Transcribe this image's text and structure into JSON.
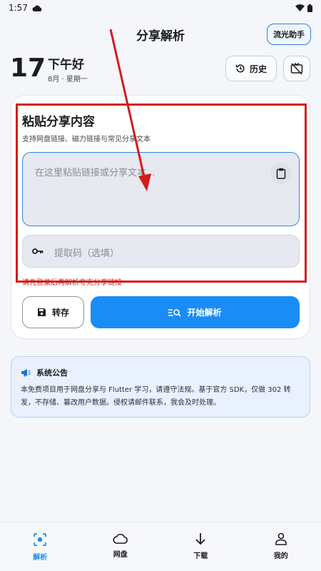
{
  "status_bar": {
    "time": "1:57"
  },
  "header": {
    "title": "分享解析",
    "assistant_button": "流光助手"
  },
  "date": {
    "day": "17",
    "greeting": "下午好",
    "subtitle": "8月 · 星期一"
  },
  "actions": {
    "history_label": "历史"
  },
  "share_card": {
    "title": "粘贴分享内容",
    "subtitle": "支持网盘链接、磁力链接与常见分享文本",
    "input_placeholder": "在这里粘贴链接或分享文本...",
    "code_placeholder": "提取码（选填）",
    "warning": "请先登录后再解析夸克分享链接",
    "save_label": "转存",
    "parse_label": "开始解析"
  },
  "notice": {
    "title": "系统公告",
    "body": "本免费项目用于网盘分享与 Flutter 学习，请遵守法规。基于官方 SDK，仅做 302 转发，不存储、篡改用户数据。侵权请邮件联系，我会及时处理。"
  },
  "bottom_nav": {
    "items": [
      {
        "label": "解析",
        "icon": "scan-icon",
        "active": true
      },
      {
        "label": "网盘",
        "icon": "cloud-icon",
        "active": false
      },
      {
        "label": "下载",
        "icon": "download-icon",
        "active": false
      },
      {
        "label": "我的",
        "icon": "person-icon",
        "active": false
      }
    ]
  },
  "colors": {
    "accent": "#1a8cf5",
    "warning": "#c62828",
    "annotation": "#d41b1b",
    "notice_bg": "#e8f1fd"
  }
}
